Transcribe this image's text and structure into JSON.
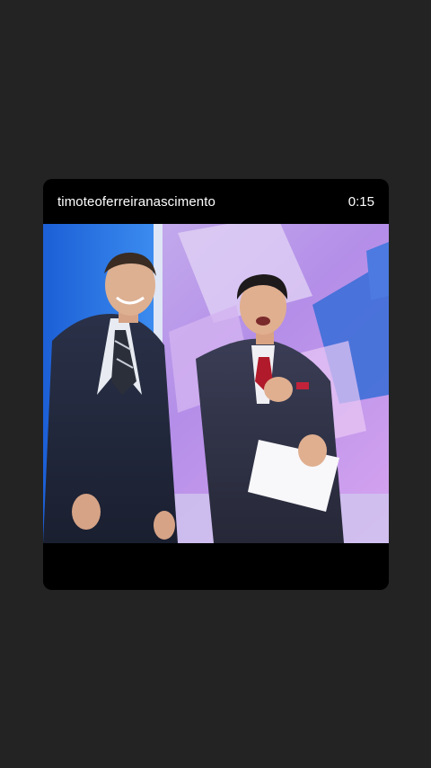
{
  "post": {
    "username": "timoteoferreiranascimento",
    "elapsed_time": "0:15"
  },
  "video": {
    "scene": "tv-studio-two-men"
  },
  "colors": {
    "background": "#232323",
    "card": "#000000",
    "text": "#ffffff"
  }
}
